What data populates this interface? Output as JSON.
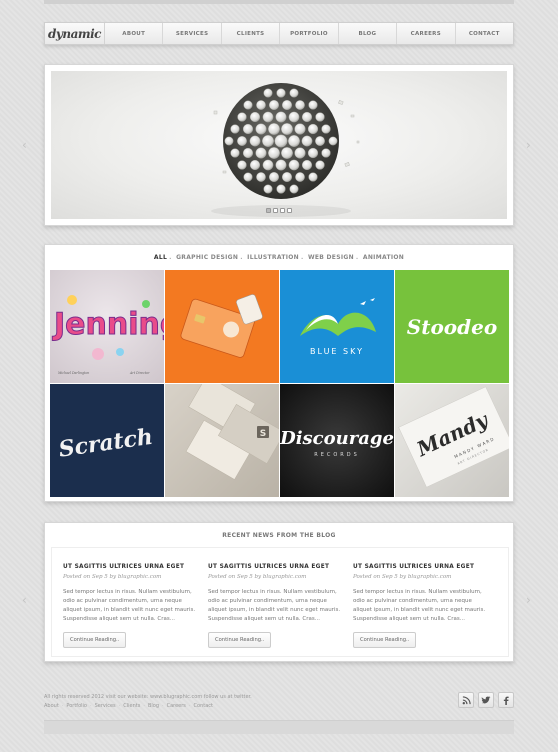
{
  "logo": "dynamic",
  "nav": [
    "ABOUT",
    "SERVICES",
    "CLIENTS",
    "PORTFOLIO",
    "BLOG",
    "CAREERS",
    "CONTACT"
  ],
  "slider": {
    "slides": 4,
    "active_slide": 1
  },
  "portfolio": {
    "filters": [
      "ALL",
      "GRAPHIC DESIGN",
      "ILLUSTRATION",
      "WEB DESIGN",
      "ANIMATION"
    ],
    "tiles": [
      {
        "text": "Jenning",
        "caption_left": "Michael Darlington",
        "caption_right": "Art Director"
      },
      {
        "text": ""
      },
      {
        "text": "BLUE SKY"
      },
      {
        "text": "Stoodeo"
      },
      {
        "text": "Scratch"
      },
      {
        "text": "S"
      },
      {
        "text": "Discourage",
        "sub": "RECORDS"
      },
      {
        "text": "Mandy",
        "sub": "MANDY WARD",
        "sub2": "ART DIRECTOR"
      }
    ]
  },
  "news": {
    "heading": "RECENT NEWS FROM THE BLOG",
    "posts": [
      {
        "title": "UT SAGITTIS ULTRICES URNA EGET",
        "meta": "Posted on Sep 5 by blugraphic.com",
        "body": "Sed tempor lectus in risus. Nullam vestibulum, odio ac pulvinar condimentum, urna neque aliquet ipsum, in blandit velit nunc eget mauris. Suspendisse aliquet sem ut nulla. Cras...",
        "button": "Continue Reading.."
      },
      {
        "title": "UT SAGITTIS ULTRICES URNA EGET",
        "meta": "Posted on Sep 5 by blugraphic.com",
        "body": "Sed tempor lectus in risus. Nullam vestibulum, odio ac pulvinar condimentum, urna neque aliquet ipsum, in blandit velit nunc eget mauris. Suspendisse aliquet sem ut nulla. Cras...",
        "button": "Continue Reading.."
      },
      {
        "title": "UT SAGITTIS ULTRICES URNA EGET",
        "meta": "Posted on Sep 5 by blugraphic.com",
        "body": "Sed tempor lectus in risus. Nullam vestibulum, odio ac pulvinar condimentum, urna neque aliquet ipsum, in blandit velit nunc eget mauris. Suspendisse aliquet sem ut nulla. Cras...",
        "button": "Continue Reading.."
      }
    ]
  },
  "footer": {
    "copyright": "All rights reserved 2012 visit our website: www.blugraphic.com follow us at twitter.",
    "links": [
      "About",
      "Portfolio",
      "Services",
      "Clients",
      "Blog",
      "Careers",
      "Contact"
    ],
    "social_icons": [
      "rss-icon",
      "twitter-icon",
      "facebook-icon"
    ]
  }
}
